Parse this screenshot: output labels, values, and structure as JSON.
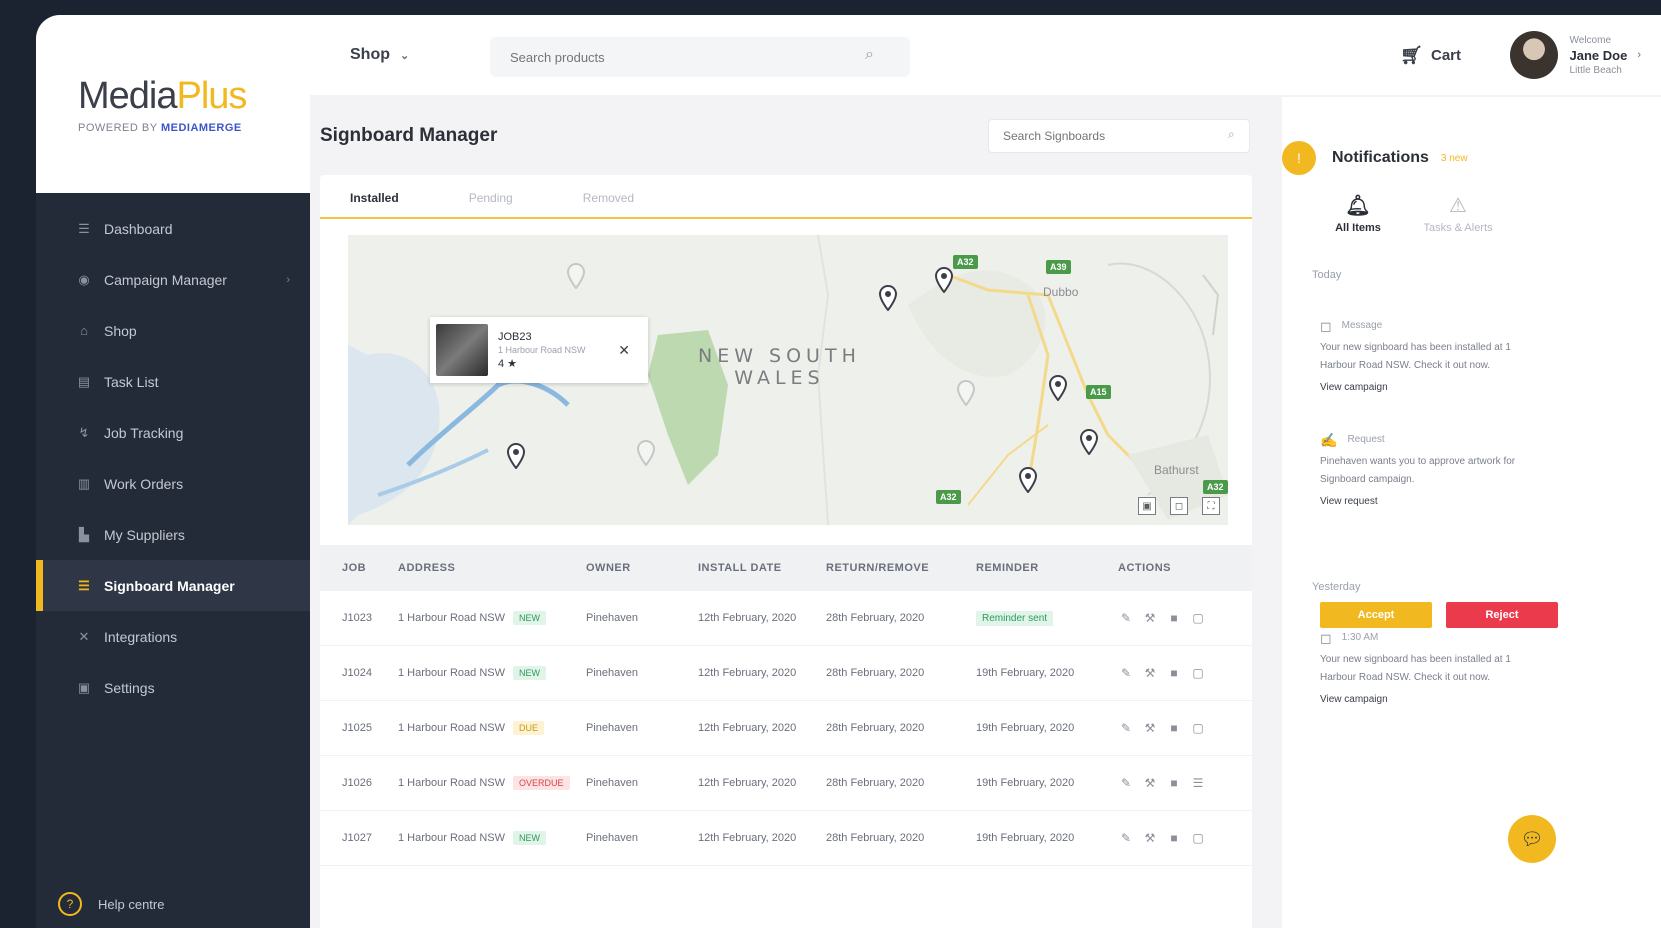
{
  "brand": {
    "name_part1": "Media",
    "name_part2": "Plus",
    "tagline_prefix": "POWERED BY",
    "tagline_brand": "MEDIAMERGE"
  },
  "sidebar": {
    "items": [
      {
        "label": "Dashboard",
        "icon": "menu-icon"
      },
      {
        "label": "Campaign Manager",
        "icon": "campaign-icon",
        "has_chevron": true
      },
      {
        "label": "Shop",
        "icon": "shop-icon"
      },
      {
        "label": "Task List",
        "icon": "task-icon"
      },
      {
        "label": "Job Tracking",
        "icon": "tracking-icon"
      },
      {
        "label": "Work Orders",
        "icon": "orders-icon"
      },
      {
        "label": "My Suppliers",
        "icon": "suppliers-icon"
      },
      {
        "label": "Signboard Manager",
        "icon": "signboard-icon",
        "active": true
      },
      {
        "label": "Integrations",
        "icon": "integrations-icon"
      },
      {
        "label": "Settings",
        "icon": "settings-icon"
      }
    ],
    "help_label": "Help centre"
  },
  "topbar": {
    "shop_label": "Shop",
    "search_placeholder": "Search products",
    "cart_label": "Cart",
    "user_greeting": "Welcome",
    "user_name": "Jane Doe",
    "user_company": "Little Beach"
  },
  "main": {
    "title": "Signboard Manager",
    "search_placeholder": "Search Signboards",
    "tabs": [
      "Installed",
      "Pending",
      "Removed"
    ],
    "active_tab": 0
  },
  "map": {
    "region_line1": "NEW SOUTH",
    "region_line2": "WALES",
    "towns": [
      "Dubbo",
      "Bathurst"
    ],
    "road_badges": [
      "A32",
      "A39",
      "A15",
      "A32",
      "A32"
    ],
    "popup": {
      "title": "JOB23",
      "subtitle": "1 Harbour Road NSW",
      "meta": "4 ★",
      "close": "✕"
    },
    "controls": [
      "▣",
      "◻",
      "⛶"
    ]
  },
  "table": {
    "headers": [
      "JOB",
      "ADDRESS",
      "OWNER",
      "INSTALL DATE",
      "RETURN/REMOVE",
      "REMINDER",
      "ACTIONS"
    ],
    "rows": [
      {
        "job": "J1023",
        "address": "1 Harbour Road NSW",
        "status": "NEW",
        "status_color": "green",
        "owner": "Pinehaven",
        "install": "12th February, 2020",
        "return": "28th February, 2020",
        "reminder": "Reminder sent",
        "reminder_badge": true
      },
      {
        "job": "J1024",
        "address": "1 Harbour Road NSW",
        "status": "NEW",
        "status_color": "green",
        "owner": "Pinehaven",
        "install": "12th February, 2020",
        "return": "28th February, 2020",
        "reminder": "19th February, 2020",
        "reminder_badge": false
      },
      {
        "job": "J1025",
        "address": "1 Harbour Road NSW",
        "status": "DUE",
        "status_color": "yellow",
        "owner": "Pinehaven",
        "install": "12th February, 2020",
        "return": "28th February, 2020",
        "reminder": "19th February, 2020",
        "reminder_badge": false
      },
      {
        "job": "J1026",
        "address": "1 Harbour Road NSW",
        "status": "OVERDUE",
        "status_color": "red",
        "owner": "Pinehaven",
        "install": "12th February, 2020",
        "return": "28th February, 2020",
        "reminder": "19th February, 2020",
        "reminder_badge": false
      },
      {
        "job": "J1027",
        "address": "1 Harbour Road NSW",
        "status": "NEW",
        "status_color": "green",
        "owner": "Pinehaven",
        "install": "12th February, 2020",
        "return": "28th February, 2020",
        "reminder": "19th February, 2020",
        "reminder_badge": false
      }
    ],
    "action_icons": [
      "edit-icon",
      "wrench-icon",
      "delete-icon",
      "calendar-icon"
    ]
  },
  "notifications": {
    "title": "Notifications",
    "count_label": "3 new",
    "tabs": [
      {
        "label": "All Items",
        "icon": "bell-icon",
        "active": true
      },
      {
        "label": "Tasks & Alerts",
        "icon": "alert-icon",
        "active": false
      }
    ],
    "sections": [
      {
        "label": "Today",
        "items": [
          {
            "meta": "Message",
            "text": "Your new signboard has been installed at 1 Harbour Road NSW. Check it out now.",
            "link": "View campaign"
          },
          {
            "meta": "Request",
            "text": "Pinehaven wants you to approve artwork for Signboard campaign.",
            "link": "View request"
          }
        ]
      },
      {
        "label": "Yesterday",
        "items": [
          {
            "meta": "1:30 AM",
            "text": "Your new signboard has been installed at 1 Harbour Road NSW. Check it out now.",
            "link": "View campaign"
          }
        ]
      }
    ],
    "accept_label": "Accept",
    "reject_label": "Reject"
  },
  "colors": {
    "accent": "#f2b820",
    "sidebar_bg": "#242b38",
    "reject": "#ea3a4b"
  }
}
